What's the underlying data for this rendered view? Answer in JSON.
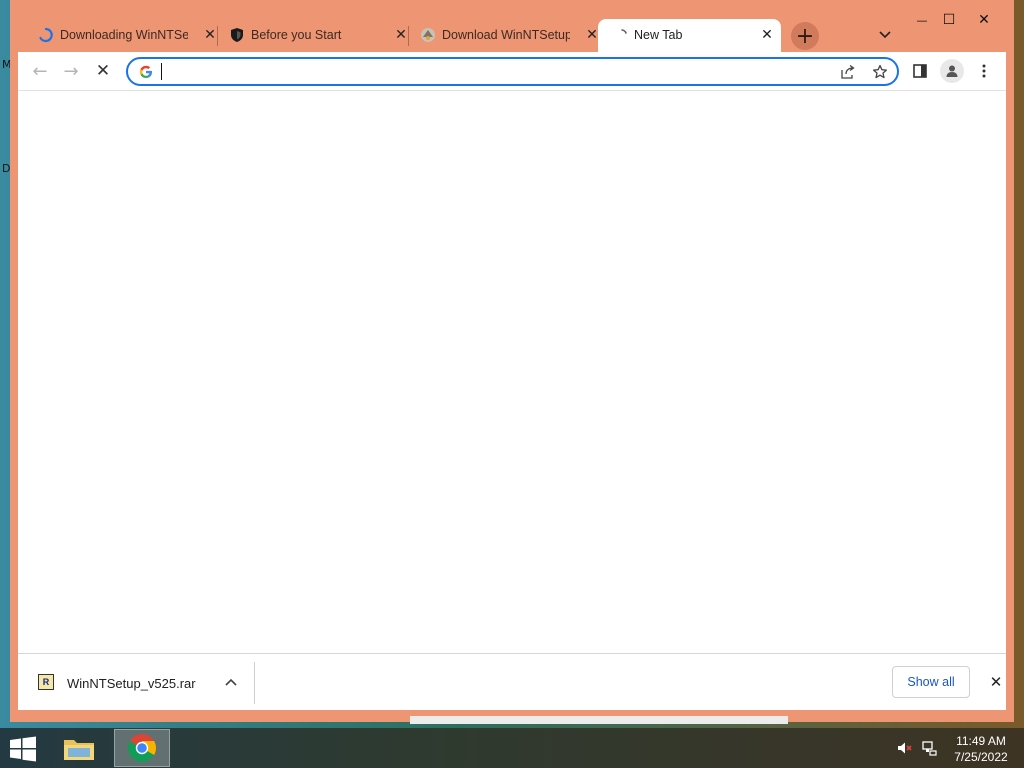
{
  "desktop": {
    "edge_text_1": "M",
    "edge_text_2": "D"
  },
  "tabs": [
    {
      "title": "Downloading WinNTSetup",
      "favicon": "loading-spinner-icon",
      "close": "✕"
    },
    {
      "title": "Before you Start",
      "favicon": "shield-icon",
      "close": "✕"
    },
    {
      "title": "Download WinNTSetup",
      "favicon": "site-logo-icon",
      "close": "✕"
    },
    {
      "title": "New Tab",
      "favicon": "loading-spinner-icon",
      "close": "✕"
    }
  ],
  "tabstrip": {
    "new_tab": "+",
    "tab_search": "⌄"
  },
  "window_controls": {
    "minimize": "—",
    "maximize": "☐",
    "close": "✕"
  },
  "toolbar": {
    "back": "←",
    "forward": "→",
    "stop": "✕",
    "omnibox_value": "",
    "omnibox_placeholder": ""
  },
  "download_shelf": {
    "file_name": "WinNTSetup_v525.rar",
    "file_icon_letter": "R",
    "chevron": "⌃",
    "show_all_label": "Show all",
    "close": "✕"
  },
  "taskbar": {
    "time": "11:49 AM",
    "date": "7/25/2022"
  },
  "colors": {
    "frame": "#ee9574",
    "accent": "#1a73e8"
  }
}
